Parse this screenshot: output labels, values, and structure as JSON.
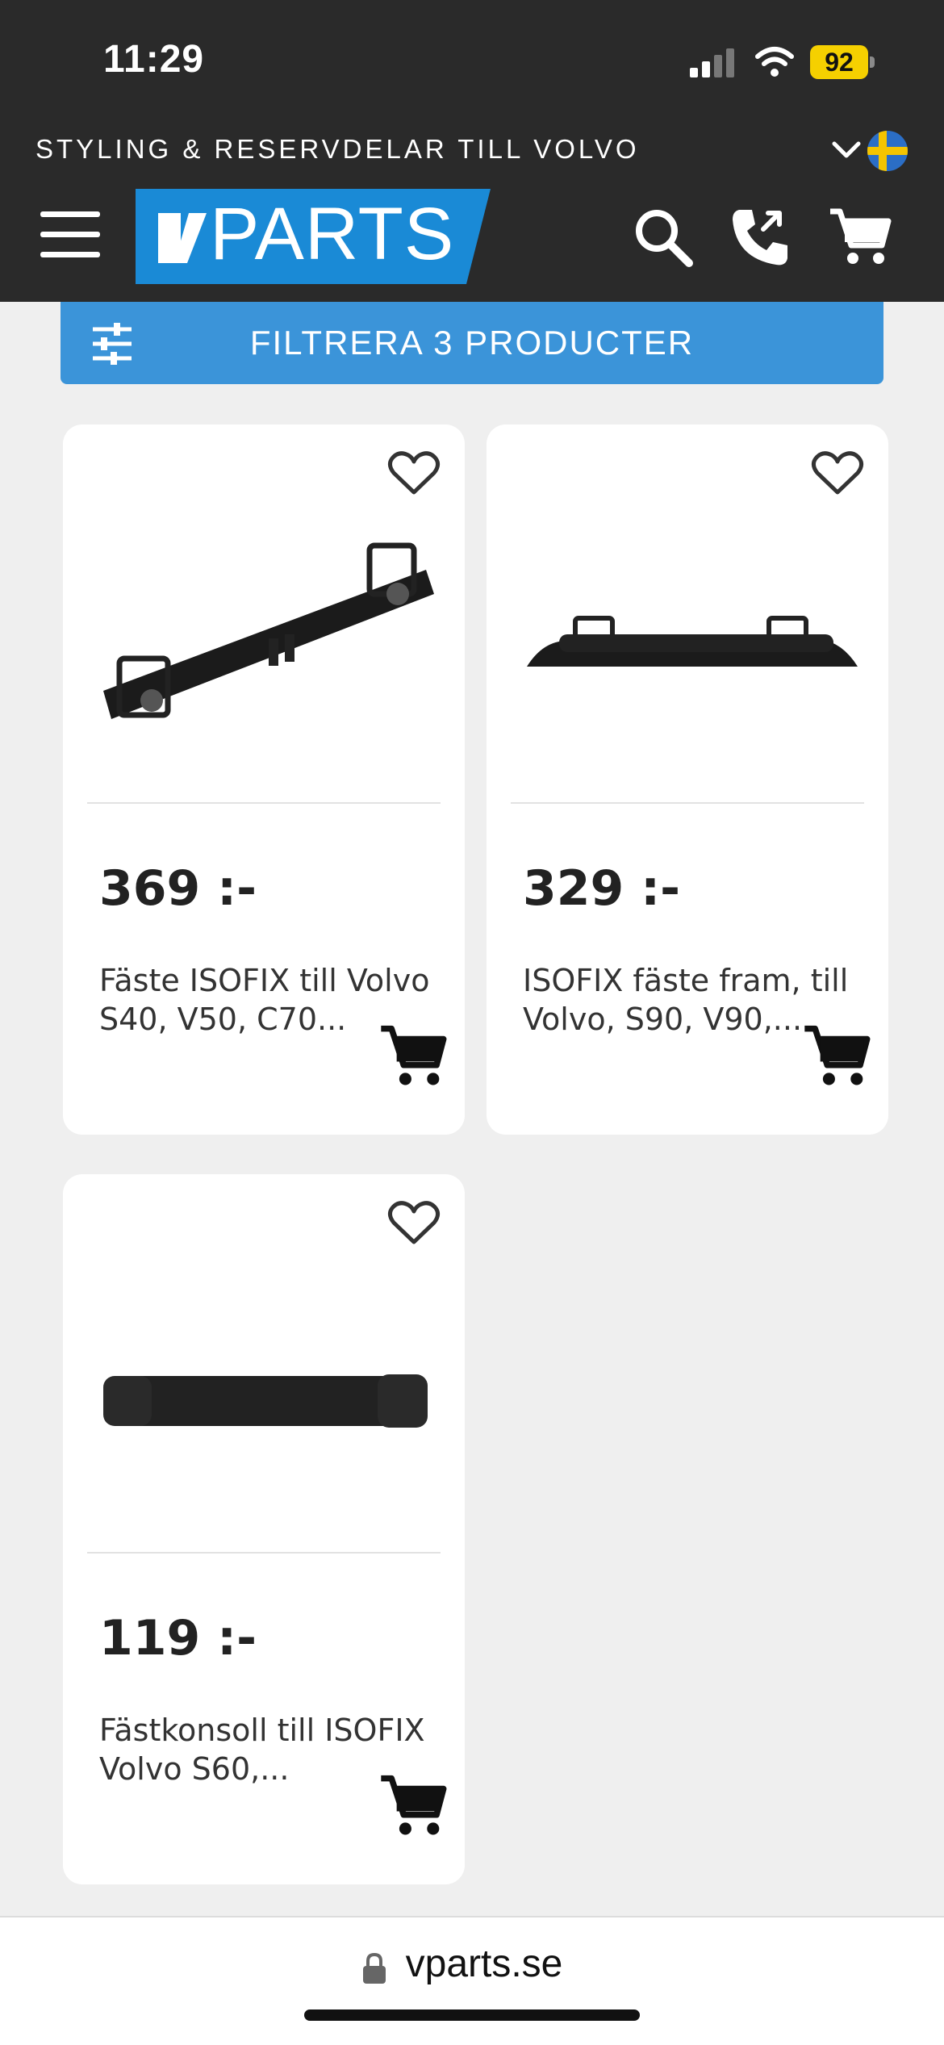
{
  "status_bar": {
    "time": "11:29",
    "battery": "92"
  },
  "header": {
    "tagline": "STYLING & RESERVDELAR TILL VOLVO",
    "logo_text": "PARTS",
    "bg_color": "#2a2a2a",
    "brand_color": "#1a8ad6",
    "icons": [
      "menu-icon",
      "search-icon",
      "phone-icon",
      "cart-icon",
      "chevron-down-icon",
      "sweden-flag-icon"
    ]
  },
  "filter": {
    "label": "FILTRERA 3 PRODUCTER",
    "color": "#3b94d9"
  },
  "products": [
    {
      "price": "369 :-",
      "title": "Fäste ISOFIX till Volvo S40, V50, C70..."
    },
    {
      "price": "329 :-",
      "title": "ISOFIX fäste fram, till Volvo, S90, V90,..."
    },
    {
      "price": "119 :-",
      "title": "Fästkonsoll till ISOFIX Volvo S60,..."
    }
  ],
  "browser": {
    "url": "vparts.se"
  }
}
